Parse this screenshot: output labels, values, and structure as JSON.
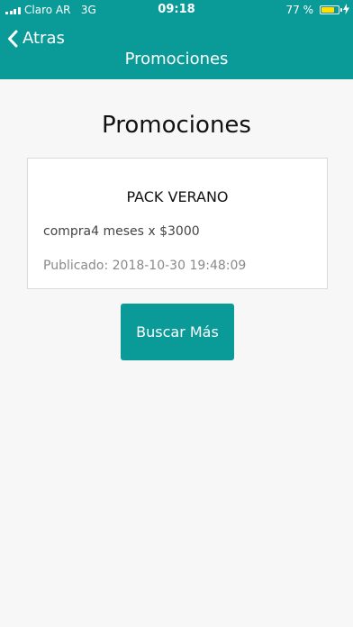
{
  "status_bar": {
    "carrier": "Claro AR",
    "network": "3G",
    "time": "09:18",
    "battery_text": "77 %",
    "battery_level": 0.77,
    "signal_icon": "signal-bars-icon",
    "battery_icon": "battery-icon",
    "charging_icon": "charging-bolt-icon"
  },
  "nav": {
    "back_label": "Atras",
    "back_icon": "chevron-left-icon",
    "title": "Promociones"
  },
  "page": {
    "title": "Promociones"
  },
  "promotions": [
    {
      "title": "PACK VERANO",
      "description": "compra4 meses x $3000",
      "published": "Publicado: 2018-10-30 19:48:09"
    }
  ],
  "actions": {
    "search_more_label": "Buscar Más"
  },
  "colors": {
    "primary": "#0a9a98",
    "background": "#f7f7f7",
    "battery": "#ffe000"
  }
}
